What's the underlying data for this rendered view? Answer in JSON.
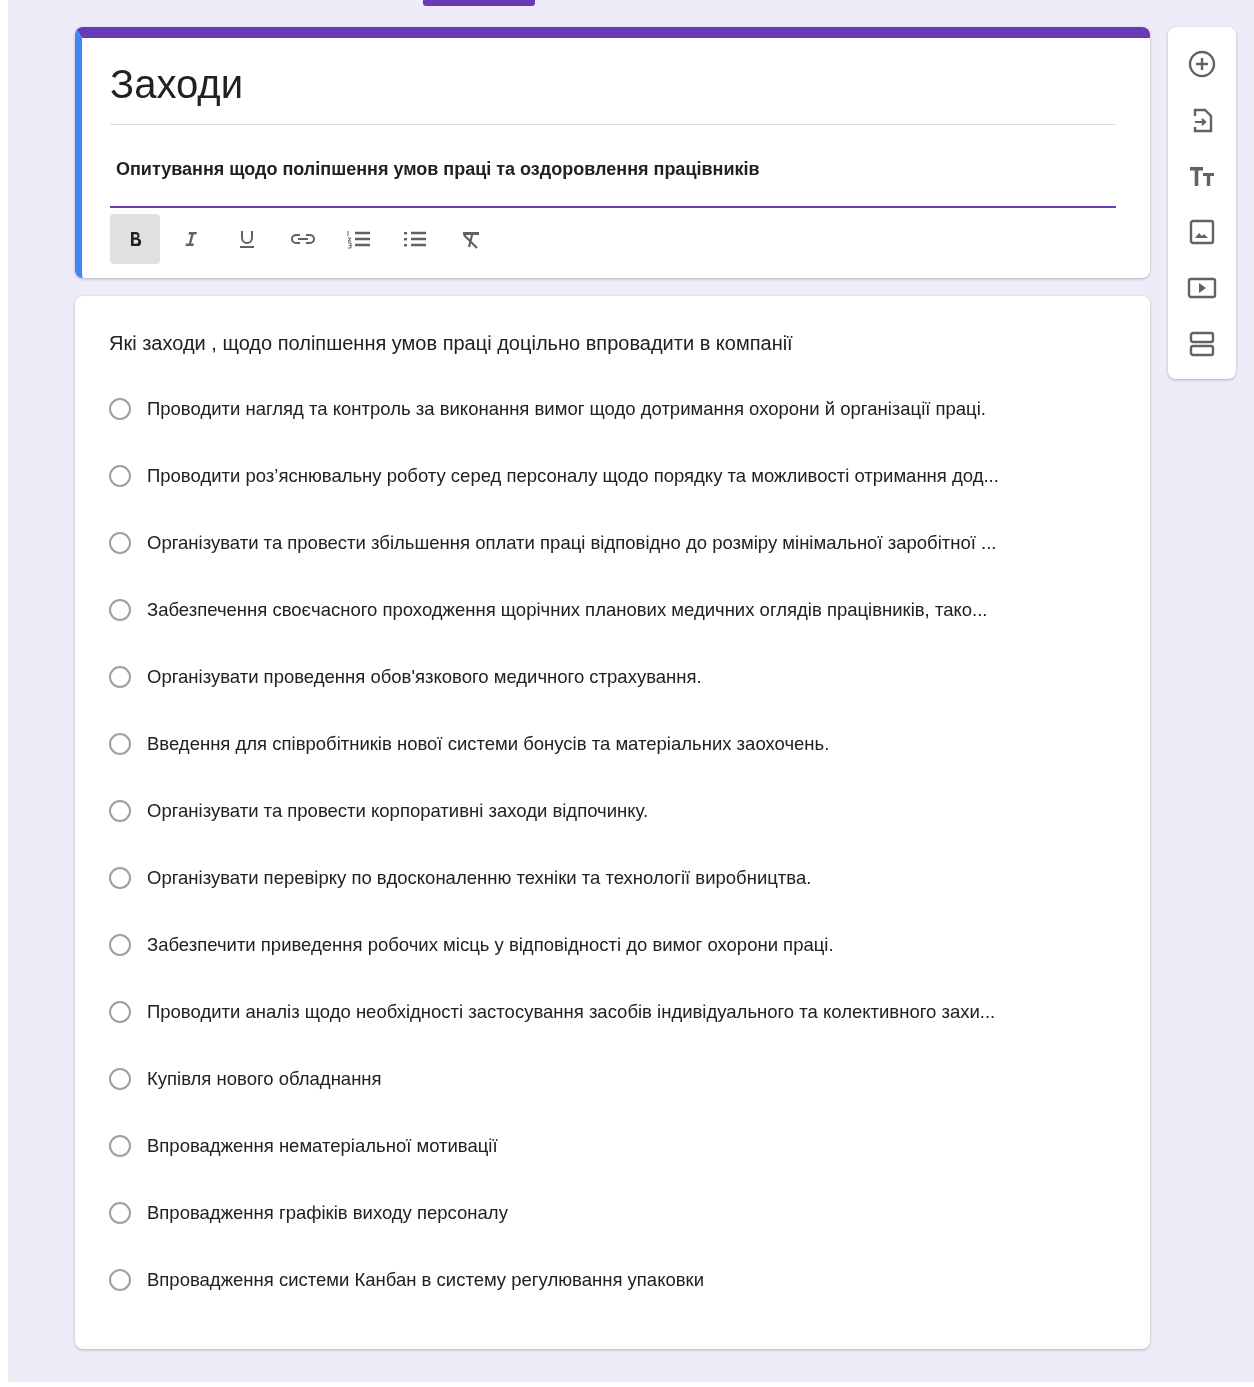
{
  "form_header": {
    "title": "Заходи",
    "description": "Опитування щодо поліпшення умов праці та оздоровлення працівників",
    "format_buttons": [
      {
        "kind": "bold",
        "active": true
      },
      {
        "kind": "italic",
        "active": false
      },
      {
        "kind": "underline",
        "active": false
      },
      {
        "kind": "link",
        "active": false
      },
      {
        "kind": "numbered",
        "active": false
      },
      {
        "kind": "bulleted",
        "active": false
      },
      {
        "kind": "clear",
        "active": false
      }
    ]
  },
  "question": {
    "title": "Які заходи , щодо поліпшення умов праці доцільно впровадити в компанії",
    "options": [
      {
        "label": "Проводити нагляд та контроль за виконання вимог щодо дотримання охорони й організації праці.",
        "selected": false
      },
      {
        "label": "Проводити роз’яснювальну роботу серед персоналу щодо порядку та можливості отримання дод...",
        "selected": false
      },
      {
        "label": "Організувати та провести збільшення оплати праці відповідно до розміру мінімальної заробітної ...",
        "selected": false
      },
      {
        "label": "Забезпечення своєчасного проходження щорічних планових медичних оглядів працівників, тако...",
        "selected": false
      },
      {
        "label": "Організувати проведення обов'язкового медичного страхування.",
        "selected": false
      },
      {
        "label": "Введення для співробітників нової системи бонусів та матеріальних заохочень.",
        "selected": false
      },
      {
        "label": "Організувати та провести корпоративні заходи відпочинку.",
        "selected": false
      },
      {
        "label": "Організувати перевірку по вдосконаленню техніки та технології виробництва.",
        "selected": false
      },
      {
        "label": "Забезпечити приведення робочих місць у відповідності до вимог охорони праці.",
        "selected": false
      },
      {
        "label": "Проводити аналіз щодо необхідності застосування засобів індивідуального та колективного захи...",
        "selected": false
      },
      {
        "label": "Купівля нового обладнання",
        "selected": false
      },
      {
        "label": "Впровадження нематеріальної мотивації",
        "selected": false
      },
      {
        "label": "Впровадження графіків виходу персоналу",
        "selected": false
      },
      {
        "label": "Впровадження системи Канбан в систему регулювання упаковки",
        "selected": false
      }
    ]
  },
  "side_toolbar": [
    {
      "kind": "add"
    },
    {
      "kind": "import"
    },
    {
      "kind": "title"
    },
    {
      "kind": "image"
    },
    {
      "kind": "video"
    },
    {
      "kind": "section"
    }
  ]
}
